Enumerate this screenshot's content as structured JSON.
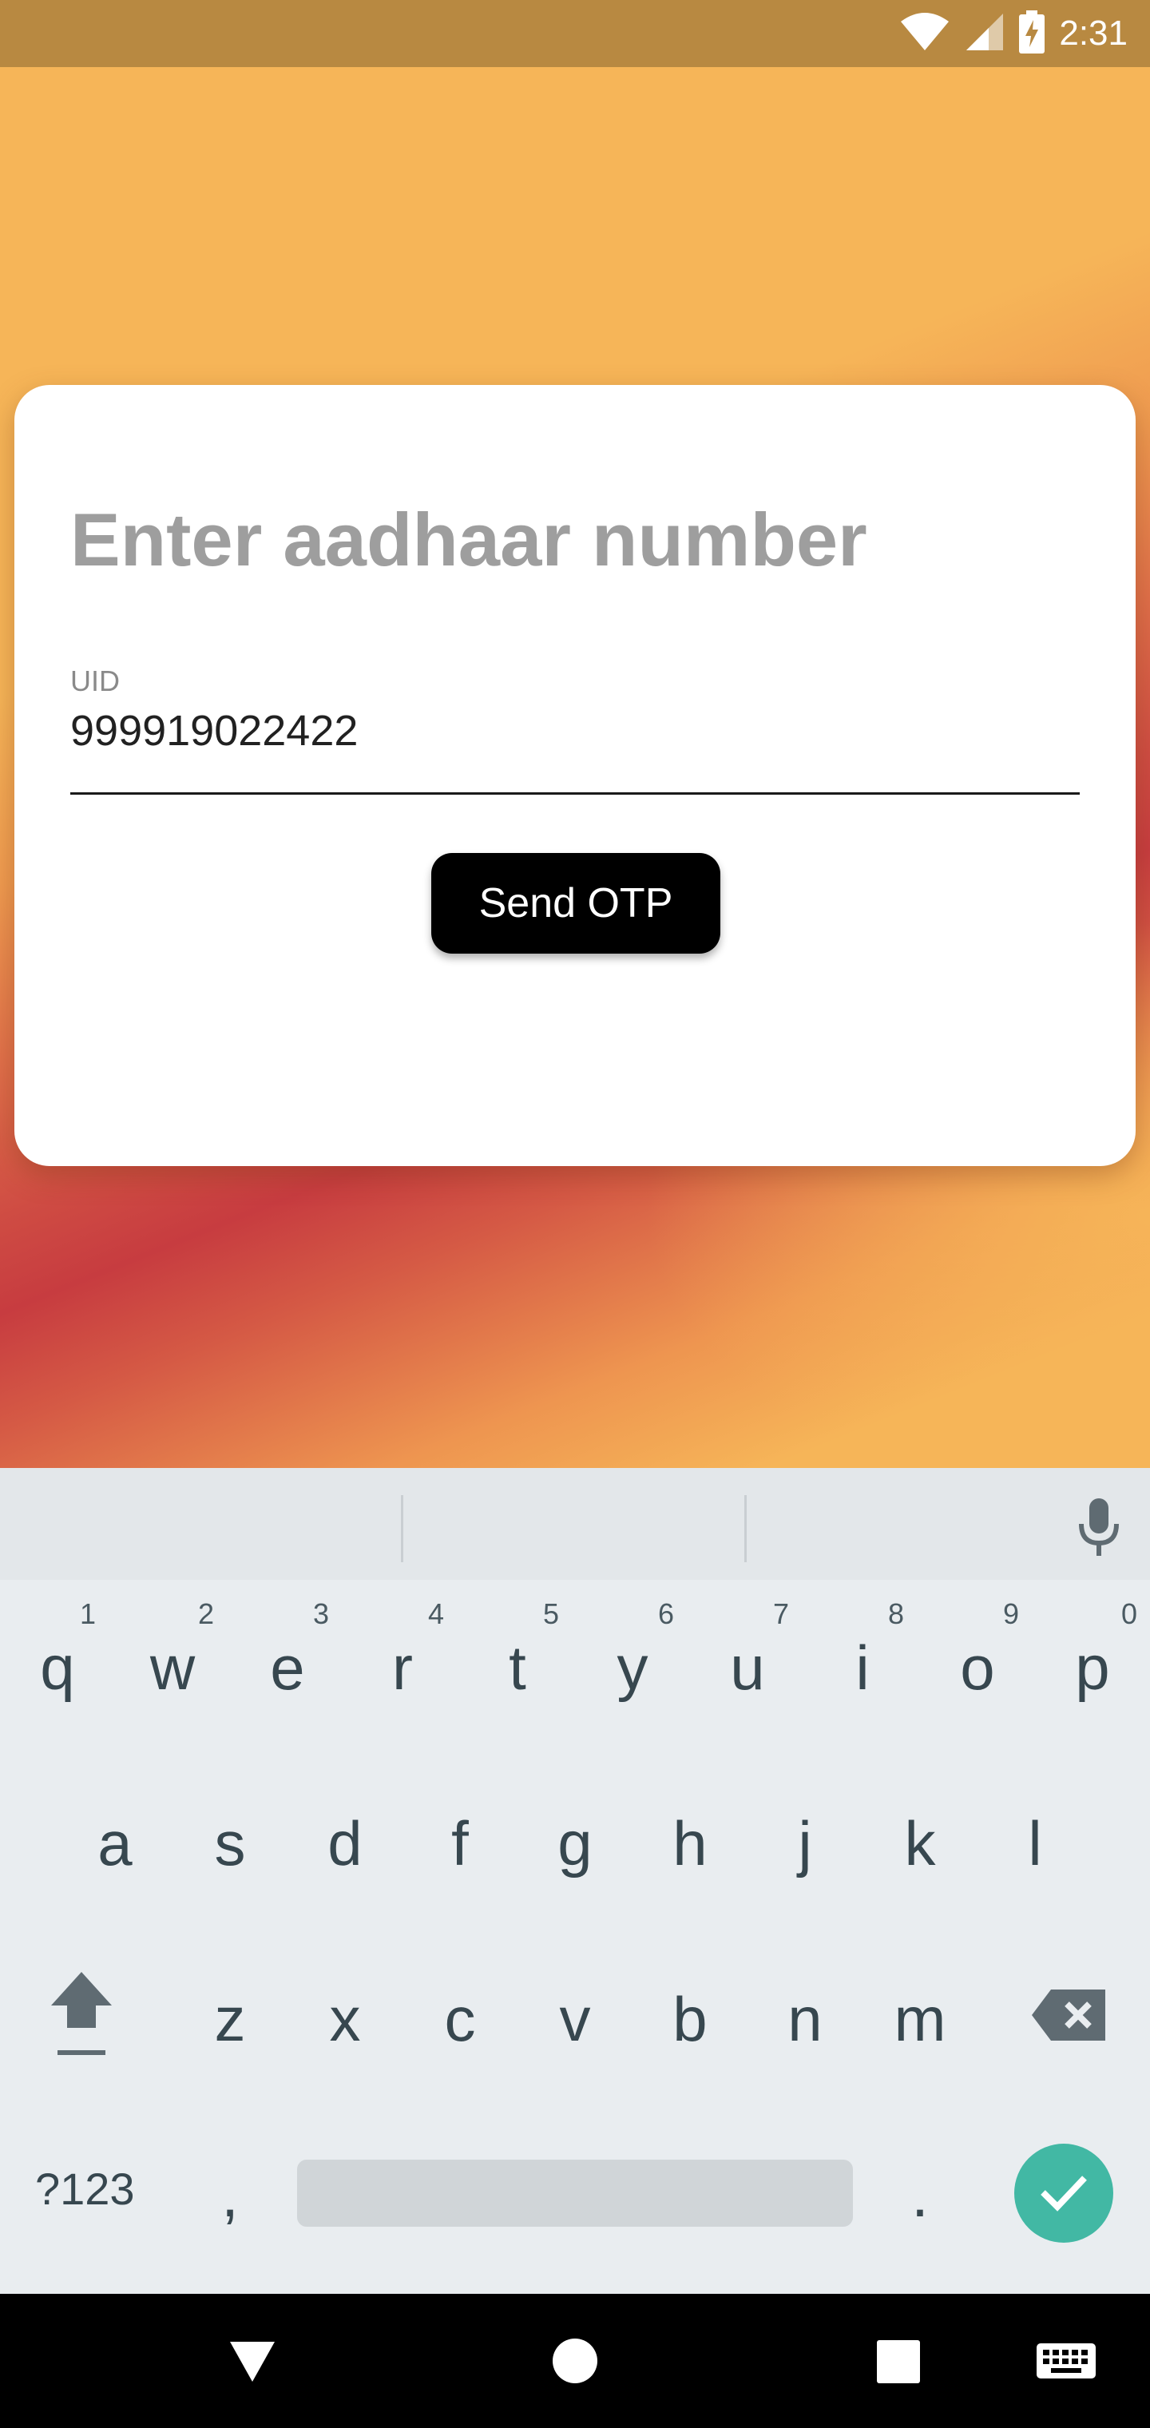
{
  "status_bar": {
    "time": "2:31",
    "icons": [
      "wifi-icon",
      "signal-icon",
      "battery-charging-icon"
    ]
  },
  "colors": {
    "status_bar": "#b88941",
    "accent": "#42b8a4",
    "button": "#000000",
    "title_gray": "#9e9e9e"
  },
  "card": {
    "title": "Enter aadhaar number",
    "uid_label": "UID",
    "uid_value": "999919022422",
    "send_button": "Send OTP"
  },
  "keyboard": {
    "row1": [
      {
        "key": "q",
        "hint": "1"
      },
      {
        "key": "w",
        "hint": "2"
      },
      {
        "key": "e",
        "hint": "3"
      },
      {
        "key": "r",
        "hint": "4"
      },
      {
        "key": "t",
        "hint": "5"
      },
      {
        "key": "y",
        "hint": "6"
      },
      {
        "key": "u",
        "hint": "7"
      },
      {
        "key": "i",
        "hint": "8"
      },
      {
        "key": "o",
        "hint": "9"
      },
      {
        "key": "p",
        "hint": "0"
      }
    ],
    "row2": [
      "a",
      "s",
      "d",
      "f",
      "g",
      "h",
      "j",
      "k",
      "l"
    ],
    "row3": [
      "z",
      "x",
      "c",
      "v",
      "b",
      "n",
      "m"
    ],
    "symbols_key": "?123",
    "comma_key": ",",
    "period_key": "."
  },
  "navbar": {
    "icons": [
      "back-icon",
      "home-icon",
      "recents-icon",
      "keyboard-switch-icon"
    ]
  }
}
